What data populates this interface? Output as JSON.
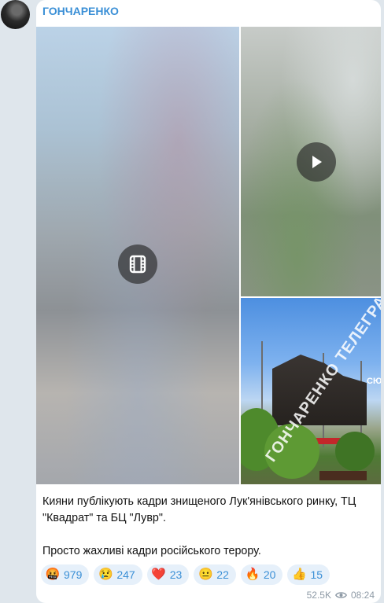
{
  "channel": {
    "author": "ГОНЧАРЕНКО",
    "avatar_icon": "channel-avatar"
  },
  "media": {
    "watermark": "ГОНЧАРЕНКО ТЕЛЕГРАМ",
    "storefront_text": "СЮ"
  },
  "post": {
    "text_line1": "Кияни публікують кадри знищеного Лук'янівського ринку, ТЦ \"Квадрат\" та БЦ \"Лувр\".",
    "text_line2": "Просто жахливі кадри російського терору."
  },
  "reactions": [
    {
      "emoji": "🤬",
      "icon": "angry-face-icon",
      "count": "979"
    },
    {
      "emoji": "😢",
      "icon": "crying-face-icon",
      "count": "247"
    },
    {
      "emoji": "❤️",
      "icon": "heart-icon",
      "count": "23"
    },
    {
      "emoji": "😐",
      "icon": "neutral-face-icon",
      "count": "22"
    },
    {
      "emoji": "🔥",
      "icon": "fire-icon",
      "count": "20"
    },
    {
      "emoji": "👍",
      "icon": "thumbs-up-icon",
      "count": "15"
    }
  ],
  "meta": {
    "views": "52.5K",
    "time": "08:24",
    "views_icon": "eye-icon"
  },
  "colors": {
    "accent": "#3a8fd6",
    "reaction_bg": "#e6f0fa",
    "chat_bg": "#dfe6ec"
  }
}
